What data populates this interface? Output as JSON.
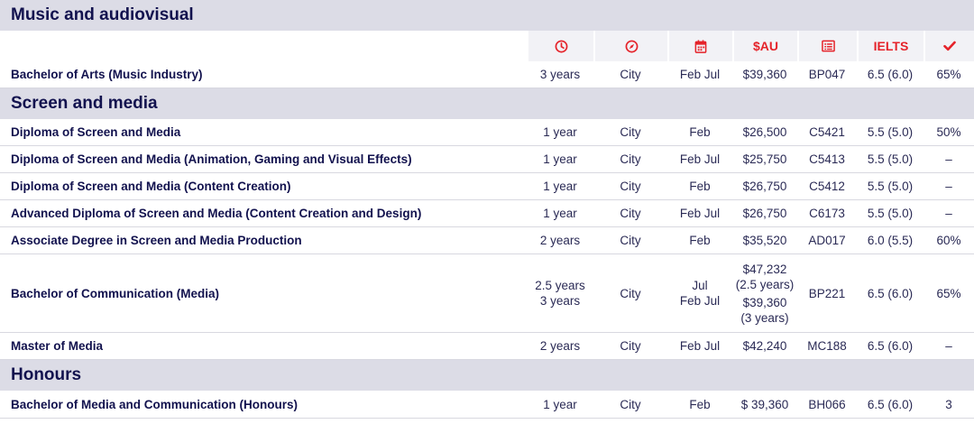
{
  "colors": {
    "accent": "#e5232a",
    "header_bg": "#dcdce6",
    "text": "#12124e"
  },
  "sections": {
    "music": {
      "title": "Music and audiovisual",
      "rows": [
        {
          "name": "Bachelor of Arts (Music Industry)",
          "duration": "3 years",
          "location": "City",
          "intake": "Feb Jul",
          "fee": "$39,360",
          "code": "BP047",
          "ielts": "6.5 (6.0)",
          "atar": "65%"
        }
      ]
    },
    "screen": {
      "title": "Screen and media",
      "rows": [
        {
          "name": "Diploma of Screen and Media",
          "duration": "1 year",
          "location": "City",
          "intake": "Feb",
          "fee": "$26,500",
          "code": "C5421",
          "ielts": "5.5 (5.0)",
          "atar": "50%"
        },
        {
          "name": "Diploma of Screen and Media (Animation, Gaming and Visual Effects)",
          "duration": "1 year",
          "location": "City",
          "intake": "Feb Jul",
          "fee": "$25,750",
          "code": "C5413",
          "ielts": "5.5 (5.0)",
          "atar": "–"
        },
        {
          "name": "Diploma of Screen and Media (Content Creation)",
          "duration": "1 year",
          "location": "City",
          "intake": "Feb",
          "fee": "$26,750",
          "code": "C5412",
          "ielts": "5.5 (5.0)",
          "atar": "–"
        },
        {
          "name": "Advanced Diploma of Screen and Media (Content Creation and Design)",
          "duration": "1 year",
          "location": "City",
          "intake": "Feb Jul",
          "fee": "$26,750",
          "code": "C6173",
          "ielts": "5.5 (5.0)",
          "atar": "–"
        },
        {
          "name": "Associate Degree in Screen and Media Production",
          "duration": "2 years",
          "location": "City",
          "intake": "Feb",
          "fee": "$35,520",
          "code": "AD017",
          "ielts": "6.0 (5.5)",
          "atar": "60%"
        }
      ],
      "bachelor_comm": {
        "name": "Bachelor of Communication (Media)",
        "duration_1": "2.5 years",
        "duration_2": "3 years",
        "location": "City",
        "intake_1": "Jul",
        "intake_2": "Feb Jul",
        "fee_1": "$47,232",
        "fee_1_note": "(2.5 years)",
        "fee_2": "$39,360",
        "fee_2_note": "(3 years)",
        "code": "BP221",
        "ielts": "6.5 (6.0)",
        "atar": "65%"
      },
      "master": {
        "name": "Master of Media",
        "duration": "2 years",
        "location": "City",
        "intake": "Feb Jul",
        "fee": "$42,240",
        "code": "MC188",
        "ielts": "6.5 (6.0)",
        "atar": "–"
      }
    },
    "honours": {
      "title": "Honours",
      "rows": [
        {
          "name": "Bachelor of Media and Communication (Honours)",
          "duration": "1 year",
          "location": "City",
          "intake": "Feb",
          "fee": "$ 39,360",
          "code": "BH066",
          "ielts": "6.5 (6.0)",
          "atar": "3"
        }
      ]
    }
  },
  "columns": {
    "duration_icon": "clock-icon",
    "location_icon": "compass-icon",
    "intake_icon": "calendar-icon",
    "fee_label": "$AU",
    "code_icon": "list-icon",
    "ielts_label": "IELTS",
    "atar_icon": "checkmark-icon"
  }
}
